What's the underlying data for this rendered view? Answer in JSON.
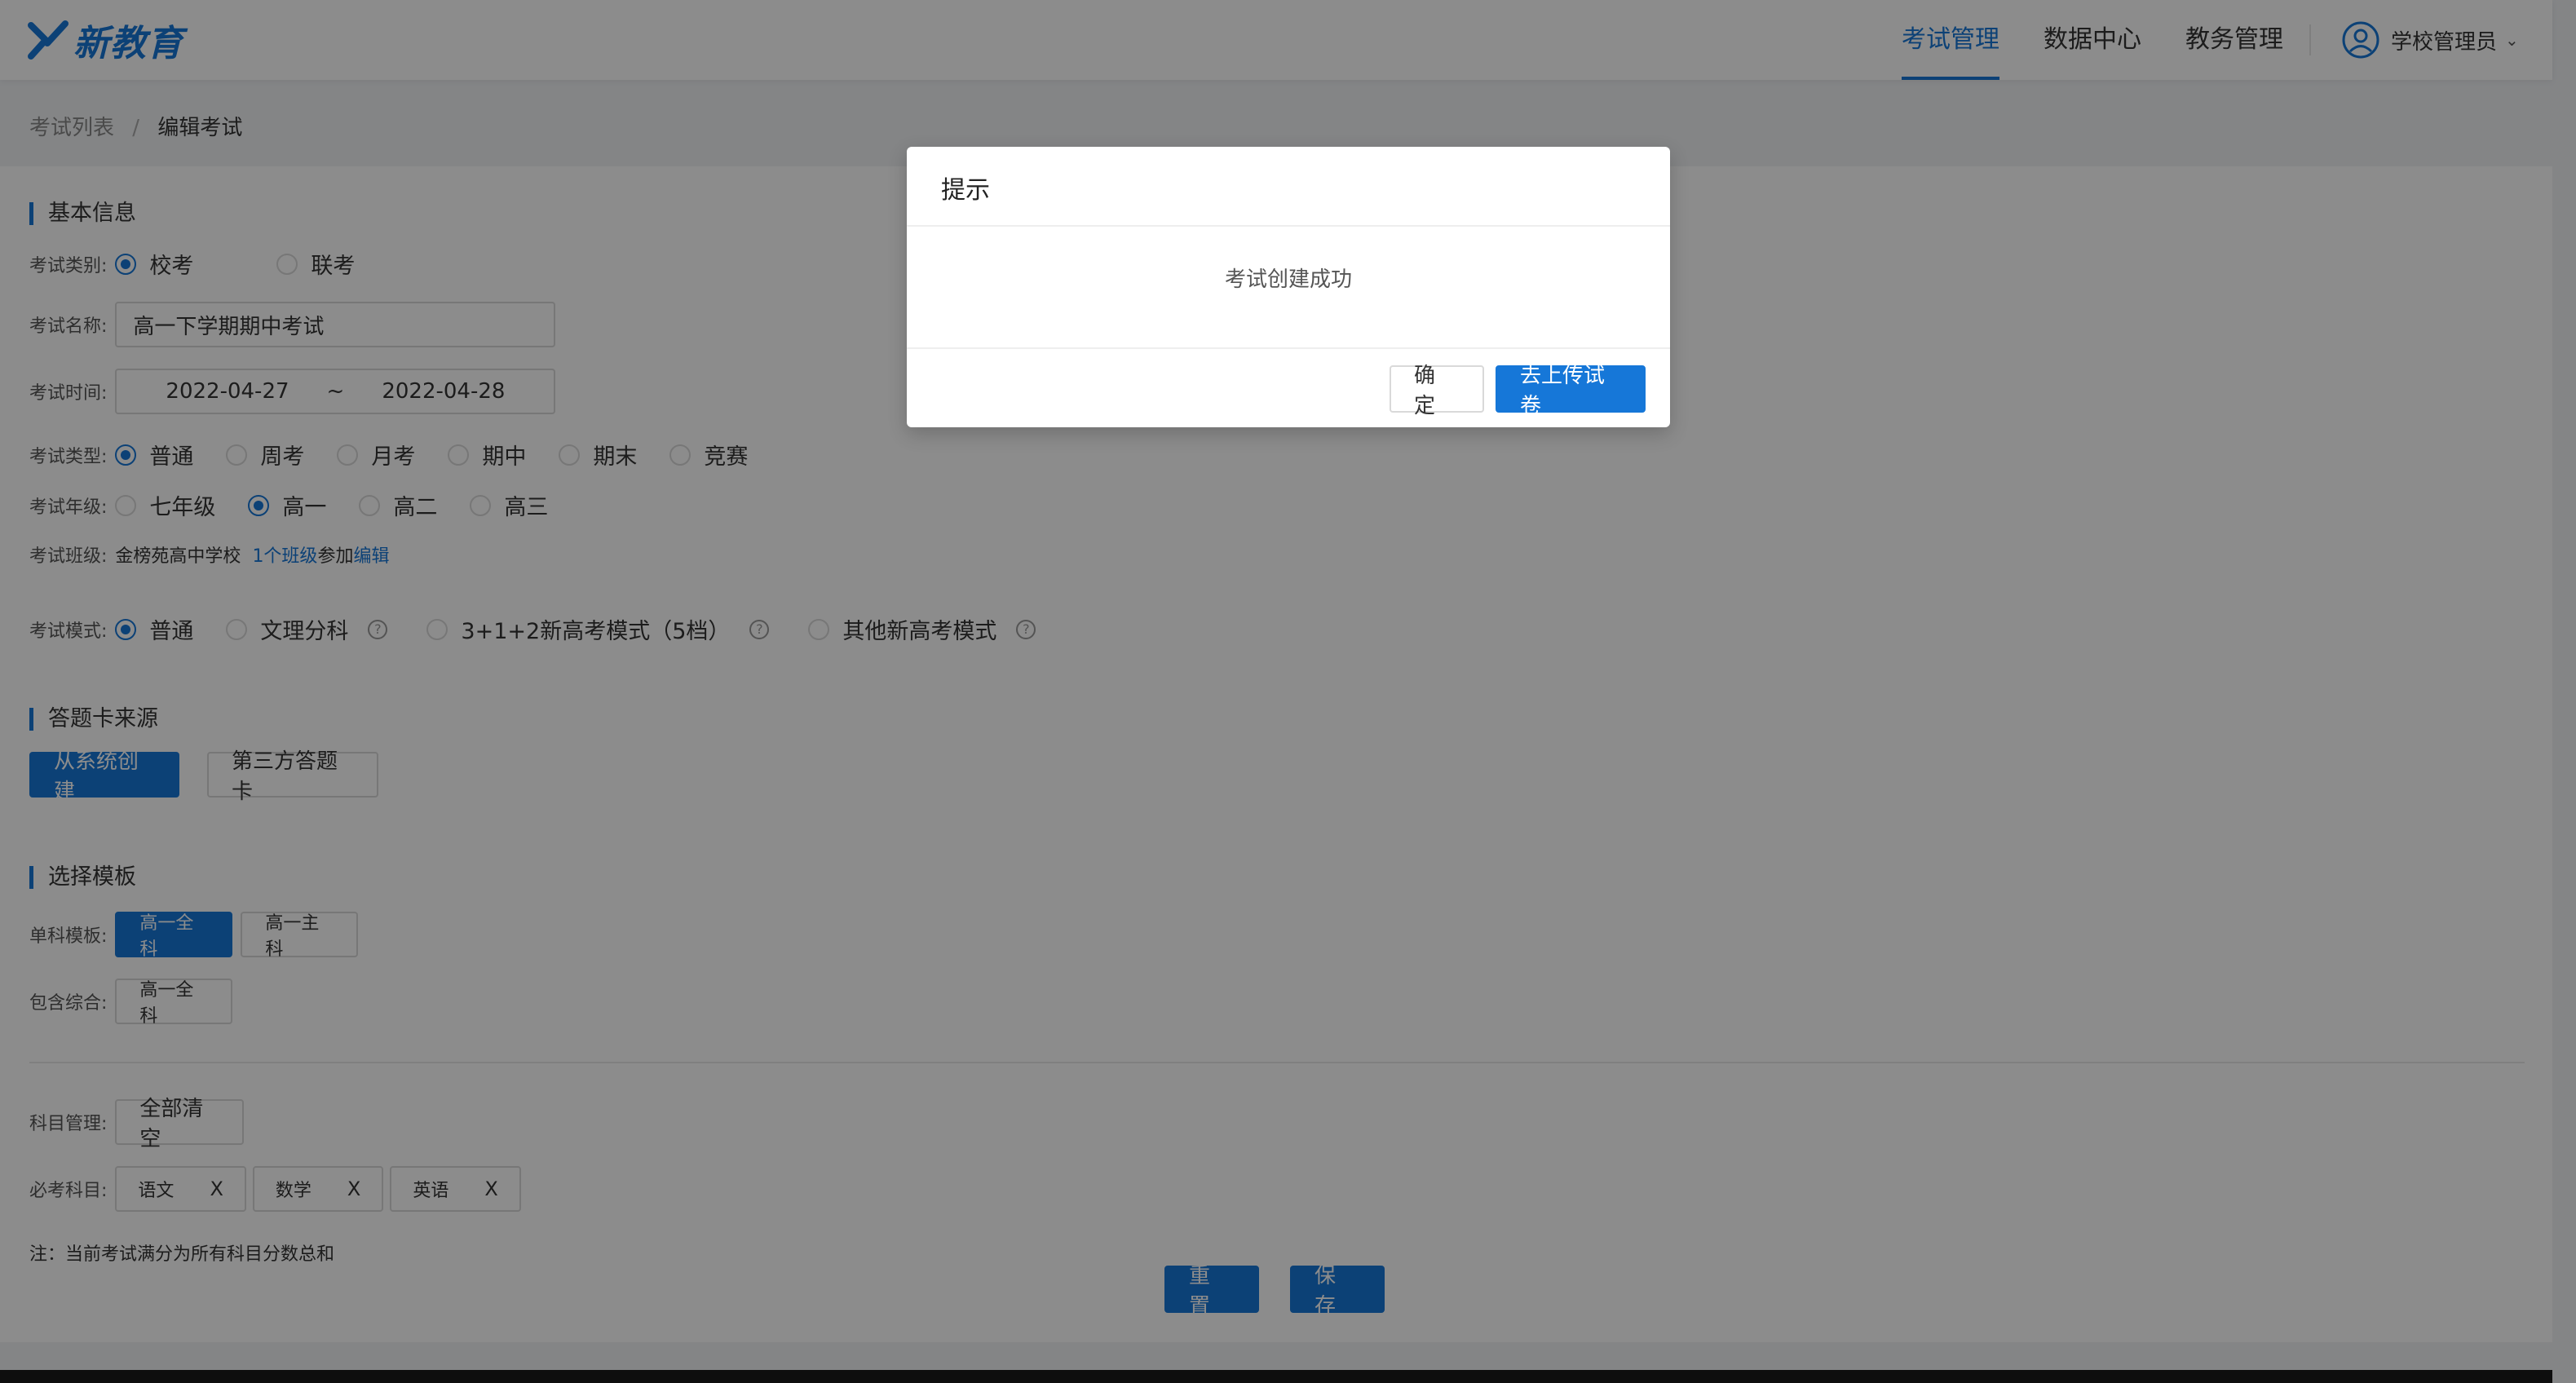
{
  "header": {
    "logo_text": "新教育",
    "nav": [
      "考试管理",
      "数据中心",
      "教务管理"
    ],
    "active_nav": 0,
    "user_name": "学校管理员"
  },
  "breadcrumb": {
    "parent": "考试列表",
    "separator": "/",
    "current": "编辑考试"
  },
  "basic_info": {
    "title": "基本信息",
    "category_label": "考试类别:",
    "category_options": [
      "校考",
      "联考"
    ],
    "name_label": "考试名称:",
    "name_value": "高一下学期期中考试",
    "time_label": "考试时间:",
    "start_date": "2022-04-27",
    "date_sep": "~",
    "end_date": "2022-04-28",
    "type_label": "考试类型:",
    "type_options": [
      "普通",
      "周考",
      "月考",
      "期中",
      "期末",
      "竞赛"
    ],
    "grade_label": "考试年级:",
    "grade_options": [
      "七年级",
      "高一",
      "高二",
      "高三"
    ],
    "class_label": "考试班级:",
    "school_name": "金榜苑高中学校",
    "class_count_text": "1个班级",
    "class_join_text": "参加",
    "class_edit_text": "编辑",
    "mode_label": "考试模式:",
    "mode_options": [
      "普通",
      "文理分科",
      "3+1+2新高考模式（5档）",
      "其他新高考模式"
    ],
    "help_glyph": "?"
  },
  "answer_card": {
    "title": "答题卡来源",
    "options": [
      "从系统创建",
      "第三方答题卡"
    ]
  },
  "template": {
    "title": "选择模板",
    "single_label": "单科模板:",
    "single_options": [
      "高一全科",
      "高一主科"
    ],
    "combined_label": "包含综合:",
    "combined_options": [
      "高一全科"
    ]
  },
  "subjects": {
    "manage_label": "科目管理:",
    "clear_all": "全部清空",
    "required_label": "必考科目:",
    "required": [
      "语文",
      "数学",
      "英语"
    ],
    "remove_glyph": "X",
    "note": "注：当前考试满分为所有科目分数总和"
  },
  "actions": {
    "reset": "重 置",
    "save": "保 存"
  },
  "dialog": {
    "title": "提示",
    "message": "考试创建成功",
    "confirm": "确 定",
    "upload": "去上传试卷"
  },
  "colors": {
    "primary": "#1677d8",
    "mask": "rgba(0,0,0,0.45)"
  }
}
